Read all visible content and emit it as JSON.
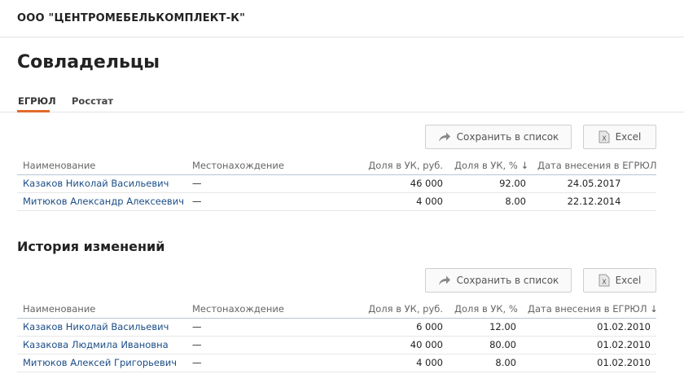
{
  "company": {
    "name": "ООО \"ЦЕНТРОМЕБЕЛЬКОМПЛЕКТ-К\""
  },
  "page": {
    "title": "Совладельцы"
  },
  "tabs": [
    {
      "label": "ЕГРЮЛ",
      "active": true
    },
    {
      "label": "Росстат",
      "active": false
    }
  ],
  "colors": {
    "accent_tab": "#e26a2c",
    "link": "#1b4d86",
    "header_rule": "#b5c6d6"
  },
  "icons": {
    "save": "share-arrow-icon",
    "excel": "excel-icon"
  },
  "actions": {
    "save_label": "Сохранить в список",
    "excel_label": "Excel",
    "excel_icon_letter": "X"
  },
  "owners": {
    "columns": [
      "Наименование",
      "Местонахождение",
      "Доля в УК, руб.",
      "Доля в УК, %",
      "Дата внесения в ЕГРЮЛ"
    ],
    "sort_indicator": "↓",
    "rows": [
      {
        "name": "Казаков Николай Васильевич",
        "location": "—",
        "amount": "46 000",
        "percent": "92.00",
        "date": "24.05.2017"
      },
      {
        "name": "Митюков Александр Алексеевич",
        "location": "—",
        "amount": "4 000",
        "percent": "8.00",
        "date": "22.12.2014"
      }
    ]
  },
  "history": {
    "title": "История изменений",
    "columns": [
      "Наименование",
      "Местонахождение",
      "Доля в УК, руб.",
      "Доля в УК, %",
      "Дата внесения в ЕГРЮЛ"
    ],
    "sort_indicator": "↓",
    "rows": [
      {
        "name": "Казаков Николай Васильевич",
        "location": "—",
        "amount": "6 000",
        "percent": "12.00",
        "date": "01.02.2010"
      },
      {
        "name": "Казакова Людмила Ивановна",
        "location": "—",
        "amount": "40 000",
        "percent": "80.00",
        "date": "01.02.2010"
      },
      {
        "name": "Митюков Алексей Григорьевич",
        "location": "—",
        "amount": "4 000",
        "percent": "8.00",
        "date": "01.02.2010"
      }
    ]
  }
}
